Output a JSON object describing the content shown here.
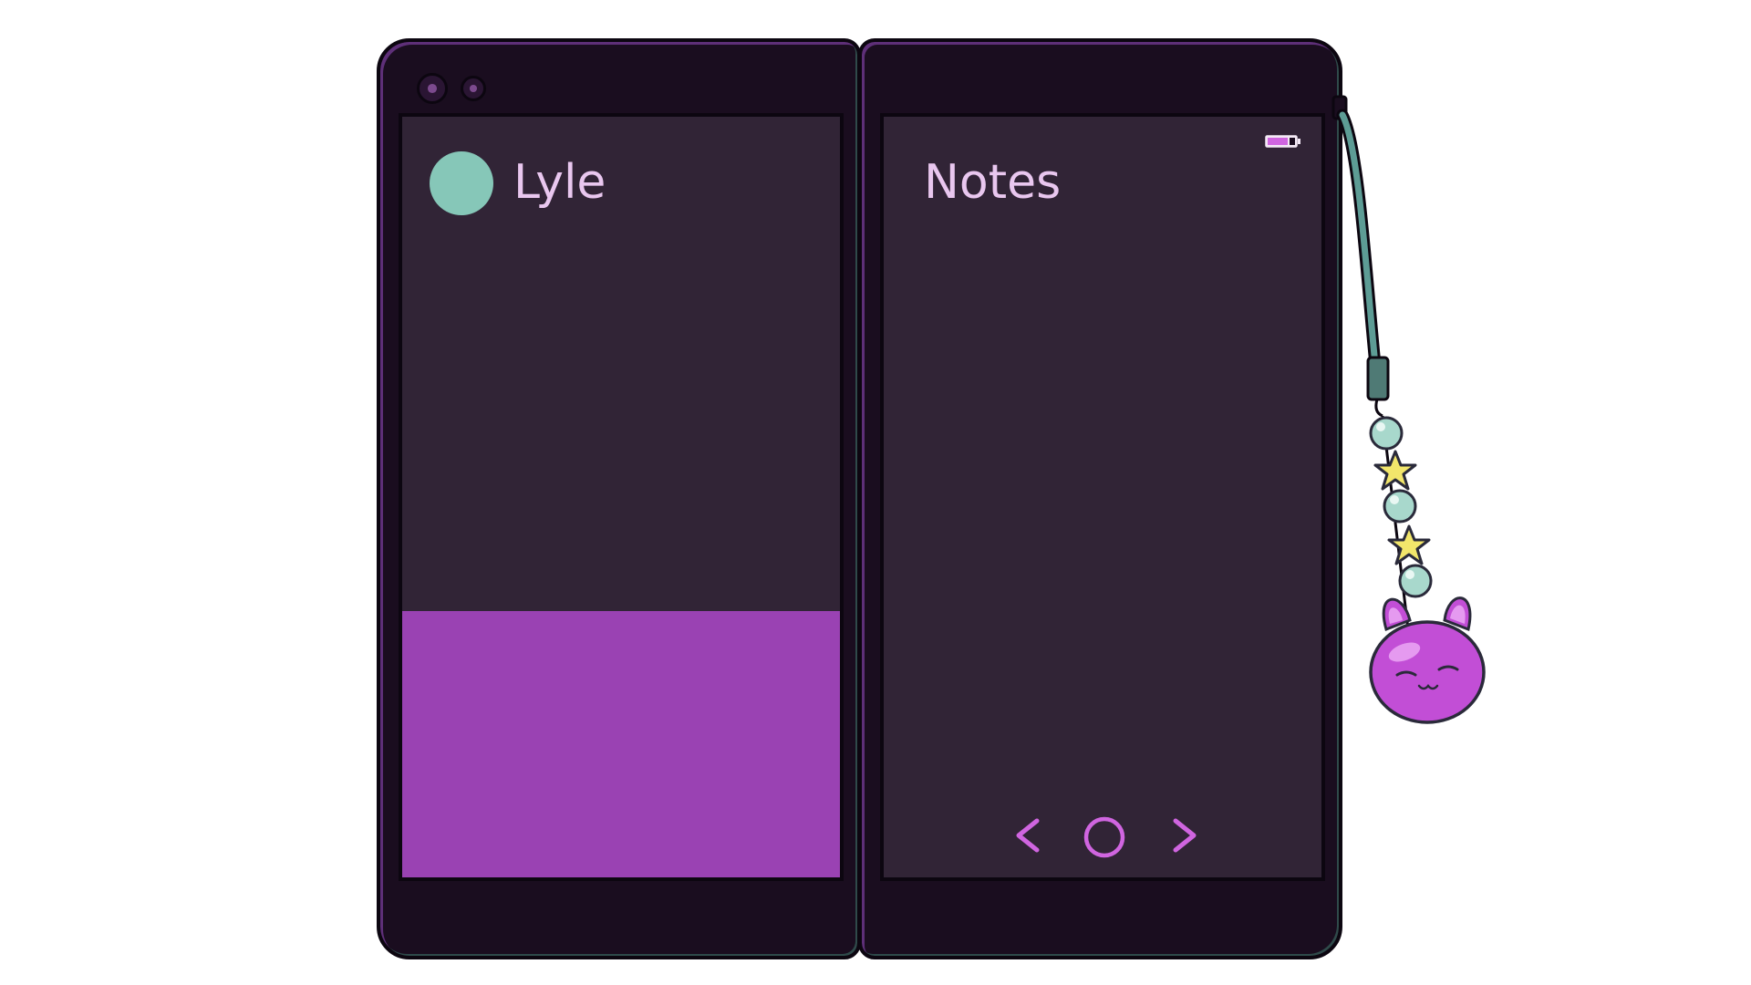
{
  "contact": {
    "name": "Lyle",
    "avatar_color": "#86c7b8"
  },
  "notes": {
    "title": "Notes"
  },
  "status": {
    "battery_icon": "battery-icon",
    "battery_color": "#d065e0"
  },
  "navigation": {
    "back_icon": "chevron-left-icon",
    "home_icon": "home-circle-icon",
    "forward_icon": "chevron-right-icon",
    "accent_color": "#d065e0"
  },
  "colors": {
    "screen_bg": "#312436",
    "device_body": "#1a0d1f",
    "text": "#e9c7ef",
    "purple_block": "#9a42b3",
    "charm_body": "#c24ed6",
    "charm_bead": "#a8d8cc",
    "charm_star": "#f2e66b"
  }
}
